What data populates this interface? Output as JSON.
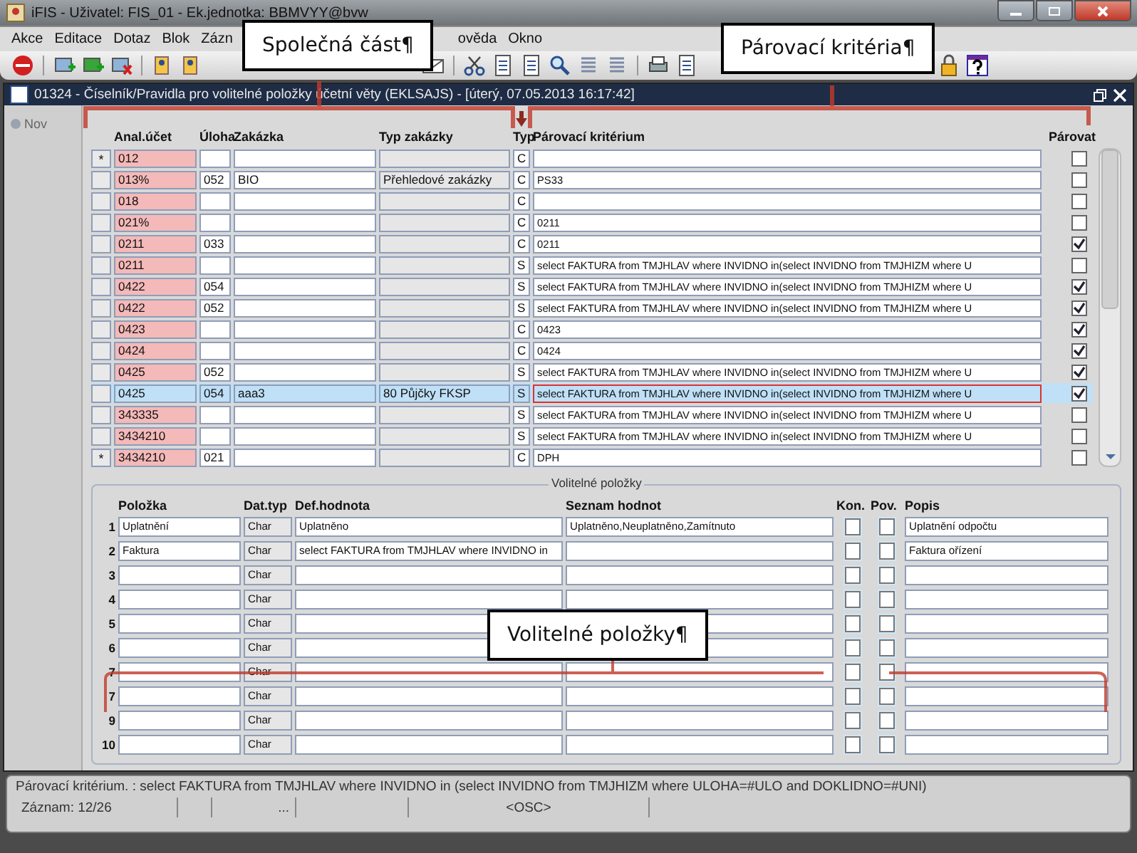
{
  "window": {
    "title": "iFIS - Uživatel: FIS_01 - Ek.jednotka: BBMVYY@bvw"
  },
  "menu": [
    "Akce",
    "Editace",
    "Dotaz",
    "Blok",
    "Zázn",
    "ověda",
    "Okno"
  ],
  "inner_window": {
    "title": "01324 - Číselník/Pravidla pro volitelné položky účetní věty (EKLSAJS) - [úterý, 07.05.2013 16:17:42]"
  },
  "sidebar": {
    "button": "Nov"
  },
  "table": {
    "columns": [
      "Anal.účet",
      "Úloha",
      "Zakázka",
      "Typ zakázky",
      "Typ",
      "Párovací kritérium",
      "Párovat"
    ],
    "rows": [
      {
        "marker": "*",
        "account": "012",
        "task": "",
        "order": "",
        "order_type": "",
        "type": "C",
        "criterion": "",
        "pair": false,
        "selected": false
      },
      {
        "marker": "",
        "account": "013%",
        "task": "052",
        "order": "BIO",
        "order_type": "Přehledové zakázky",
        "type": "C",
        "criterion": "PS33",
        "pair": false,
        "selected": false
      },
      {
        "marker": "",
        "account": "018",
        "task": "",
        "order": "",
        "order_type": "",
        "type": "C",
        "criterion": "",
        "pair": false,
        "selected": false
      },
      {
        "marker": "",
        "account": "021%",
        "task": "",
        "order": "",
        "order_type": "",
        "type": "C",
        "criterion": "0211",
        "pair": false,
        "selected": false
      },
      {
        "marker": "",
        "account": "0211",
        "task": "033",
        "order": "",
        "order_type": "",
        "type": "C",
        "criterion": "0211",
        "pair": true,
        "selected": false
      },
      {
        "marker": "",
        "account": "0211",
        "task": "",
        "order": "",
        "order_type": "",
        "type": "S",
        "criterion": "select FAKTURA from TMJHLAV where INVIDNO in(select INVIDNO from TMJHIZM where U",
        "pair": false,
        "selected": false
      },
      {
        "marker": "",
        "account": "0422",
        "task": "054",
        "order": "",
        "order_type": "",
        "type": "S",
        "criterion": "select FAKTURA from TMJHLAV where INVIDNO in(select INVIDNO from TMJHIZM where U",
        "pair": true,
        "selected": false
      },
      {
        "marker": "",
        "account": "0422",
        "task": "052",
        "order": "",
        "order_type": "",
        "type": "S",
        "criterion": "select FAKTURA from TMJHLAV where INVIDNO in(select INVIDNO from TMJHIZM where U",
        "pair": true,
        "selected": false
      },
      {
        "marker": "",
        "account": "0423",
        "task": "",
        "order": "",
        "order_type": "",
        "type": "C",
        "criterion": "0423",
        "pair": true,
        "selected": false
      },
      {
        "marker": "",
        "account": "0424",
        "task": "",
        "order": "",
        "order_type": "",
        "type": "C",
        "criterion": "0424",
        "pair": true,
        "selected": false
      },
      {
        "marker": "",
        "account": "0425",
        "task": "052",
        "order": "",
        "order_type": "",
        "type": "S",
        "criterion": "select FAKTURA from TMJHLAV where INVIDNO in(select INVIDNO from TMJHIZM where U",
        "pair": true,
        "selected": false
      },
      {
        "marker": "",
        "account": "0425",
        "task": "054",
        "order": "aaa3",
        "order_type": "80 Půjčky FKSP",
        "type": "S",
        "criterion": "select FAKTURA from TMJHLAV where INVIDNO in(select INVIDNO from TMJHIZM where U",
        "pair": true,
        "selected": true
      },
      {
        "marker": "",
        "account": "343335",
        "task": "",
        "order": "",
        "order_type": "",
        "type": "S",
        "criterion": "select FAKTURA from TMJHLAV where INVIDNO in(select INVIDNO from TMJHIZM where U",
        "pair": false,
        "selected": false
      },
      {
        "marker": "",
        "account": "3434210",
        "task": "",
        "order": "",
        "order_type": "",
        "type": "S",
        "criterion": "select FAKTURA from TMJHLAV where INVIDNO in(select INVIDNO from TMJHIZM where U",
        "pair": false,
        "selected": false
      },
      {
        "marker": "*",
        "account": "3434210",
        "task": "021",
        "order": "",
        "order_type": "",
        "type": "C",
        "criterion": "DPH",
        "pair": false,
        "selected": false
      }
    ]
  },
  "optional_items": {
    "title": "Volitelné položky",
    "columns": [
      "Položka",
      "Dat.typ",
      "Def.hodnota",
      "Seznam hodnot",
      "Kon.",
      "Pov.",
      "Popis"
    ],
    "rows": [
      {
        "number": "1",
        "item": "Uplatnění",
        "data_type": "Char",
        "default": "Uplatněno",
        "values": "Uplatněno,Neuplatněno,Zamítnuto",
        "kon": false,
        "pov": false,
        "description": "Uplatnění odpočtu"
      },
      {
        "number": "2",
        "item": "Faktura",
        "data_type": "Char",
        "default": "select FAKTURA from TMJHLAV where INVIDNO in",
        "values": "",
        "kon": false,
        "pov": false,
        "description": "Faktura ořízení"
      },
      {
        "number": "3",
        "item": "",
        "data_type": "Char",
        "default": "",
        "values": "",
        "kon": false,
        "pov": false,
        "description": ""
      },
      {
        "number": "4",
        "item": "",
        "data_type": "Char",
        "default": "",
        "values": "",
        "kon": false,
        "pov": false,
        "description": ""
      },
      {
        "number": "5",
        "item": "",
        "data_type": "Char",
        "default": "",
        "values": "",
        "kon": false,
        "pov": false,
        "description": ""
      },
      {
        "number": "6",
        "item": "",
        "data_type": "Char",
        "default": "",
        "values": "",
        "kon": false,
        "pov": false,
        "description": ""
      },
      {
        "number": "7",
        "item": "",
        "data_type": "Char",
        "default": "",
        "values": "",
        "kon": false,
        "pov": false,
        "description": ""
      },
      {
        "number": "7",
        "item": "",
        "data_type": "Char",
        "default": "",
        "values": "",
        "kon": false,
        "pov": false,
        "description": ""
      },
      {
        "number": "9",
        "item": "",
        "data_type": "Char",
        "default": "",
        "values": "",
        "kon": false,
        "pov": false,
        "description": ""
      },
      {
        "number": "10",
        "item": "",
        "data_type": "Char",
        "default": "",
        "values": "",
        "kon": false,
        "pov": false,
        "description": ""
      }
    ]
  },
  "status_bar": {
    "message": "Párovací kritérium. : select FAKTURA from TMJHLAV where INVIDNO in (select INVIDNO from TMJHIZM where ULOHA=#ULO and DOKLIDNO=#UNI)",
    "record": "Záznam: 12/26",
    "ellipsis": "...",
    "mode": "<OSC>"
  },
  "annotations": [
    {
      "text": "Společná část¶"
    },
    {
      "text": "Párovací kritéria¶"
    },
    {
      "text": "Volitelné položky¶"
    }
  ]
}
